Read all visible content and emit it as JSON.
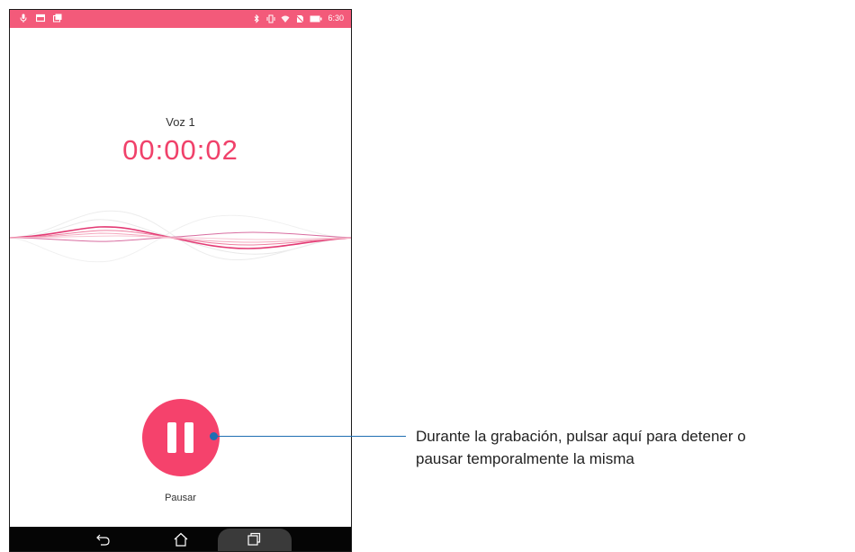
{
  "status_bar": {
    "left_icons": [
      "microphone-icon",
      "image-icon",
      "gallery-icon"
    ],
    "right_icons": [
      "bluetooth-icon",
      "vibrate-icon",
      "wifi-icon",
      "no-sim-icon",
      "battery-icon"
    ],
    "time": "6:30",
    "color": "#f35a7a"
  },
  "recording": {
    "title": "Voz 1",
    "timer": "00:00:02",
    "accent_color": "#f0416a"
  },
  "controls": {
    "pause_label": "Pausar",
    "pause_icon": "pause-icon",
    "button_color": "#f5426c"
  },
  "nav_bar": {
    "icons": [
      "back-icon",
      "home-icon",
      "recent-apps-icon"
    ]
  },
  "callout": {
    "line1": "Durante la grabación, pulsar aquí para detener o",
    "line2": "pausar temporalmente la misma",
    "line_color": "#1f6fb3"
  }
}
